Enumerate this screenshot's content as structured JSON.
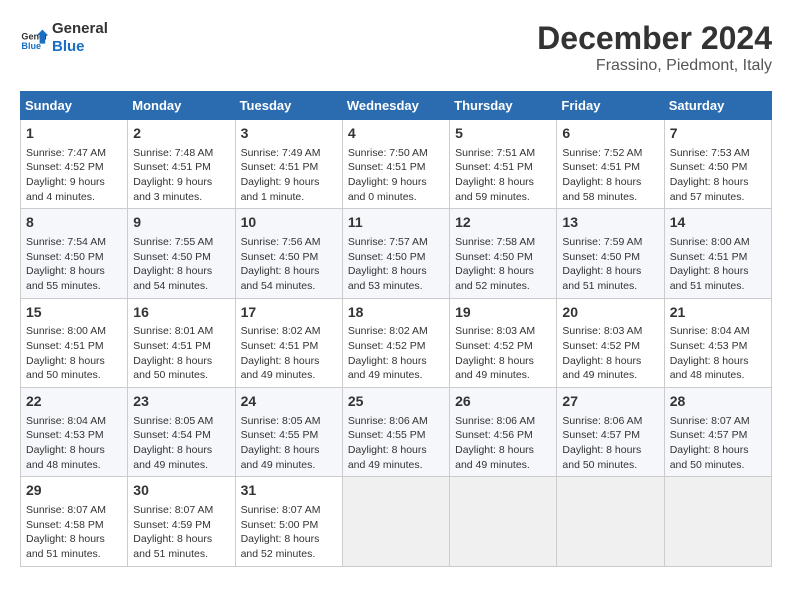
{
  "logo": {
    "line1": "General",
    "line2": "Blue"
  },
  "title": "December 2024",
  "subtitle": "Frassino, Piedmont, Italy",
  "days_of_week": [
    "Sunday",
    "Monday",
    "Tuesday",
    "Wednesday",
    "Thursday",
    "Friday",
    "Saturday"
  ],
  "weeks": [
    [
      {
        "day": "1",
        "info": "Sunrise: 7:47 AM\nSunset: 4:52 PM\nDaylight: 9 hours\nand 4 minutes."
      },
      {
        "day": "2",
        "info": "Sunrise: 7:48 AM\nSunset: 4:51 PM\nDaylight: 9 hours\nand 3 minutes."
      },
      {
        "day": "3",
        "info": "Sunrise: 7:49 AM\nSunset: 4:51 PM\nDaylight: 9 hours\nand 1 minute."
      },
      {
        "day": "4",
        "info": "Sunrise: 7:50 AM\nSunset: 4:51 PM\nDaylight: 9 hours\nand 0 minutes."
      },
      {
        "day": "5",
        "info": "Sunrise: 7:51 AM\nSunset: 4:51 PM\nDaylight: 8 hours\nand 59 minutes."
      },
      {
        "day": "6",
        "info": "Sunrise: 7:52 AM\nSunset: 4:51 PM\nDaylight: 8 hours\nand 58 minutes."
      },
      {
        "day": "7",
        "info": "Sunrise: 7:53 AM\nSunset: 4:50 PM\nDaylight: 8 hours\nand 57 minutes."
      }
    ],
    [
      {
        "day": "8",
        "info": "Sunrise: 7:54 AM\nSunset: 4:50 PM\nDaylight: 8 hours\nand 55 minutes."
      },
      {
        "day": "9",
        "info": "Sunrise: 7:55 AM\nSunset: 4:50 PM\nDaylight: 8 hours\nand 54 minutes."
      },
      {
        "day": "10",
        "info": "Sunrise: 7:56 AM\nSunset: 4:50 PM\nDaylight: 8 hours\nand 54 minutes."
      },
      {
        "day": "11",
        "info": "Sunrise: 7:57 AM\nSunset: 4:50 PM\nDaylight: 8 hours\nand 53 minutes."
      },
      {
        "day": "12",
        "info": "Sunrise: 7:58 AM\nSunset: 4:50 PM\nDaylight: 8 hours\nand 52 minutes."
      },
      {
        "day": "13",
        "info": "Sunrise: 7:59 AM\nSunset: 4:50 PM\nDaylight: 8 hours\nand 51 minutes."
      },
      {
        "day": "14",
        "info": "Sunrise: 8:00 AM\nSunset: 4:51 PM\nDaylight: 8 hours\nand 51 minutes."
      }
    ],
    [
      {
        "day": "15",
        "info": "Sunrise: 8:00 AM\nSunset: 4:51 PM\nDaylight: 8 hours\nand 50 minutes."
      },
      {
        "day": "16",
        "info": "Sunrise: 8:01 AM\nSunset: 4:51 PM\nDaylight: 8 hours\nand 50 minutes."
      },
      {
        "day": "17",
        "info": "Sunrise: 8:02 AM\nSunset: 4:51 PM\nDaylight: 8 hours\nand 49 minutes."
      },
      {
        "day": "18",
        "info": "Sunrise: 8:02 AM\nSunset: 4:52 PM\nDaylight: 8 hours\nand 49 minutes."
      },
      {
        "day": "19",
        "info": "Sunrise: 8:03 AM\nSunset: 4:52 PM\nDaylight: 8 hours\nand 49 minutes."
      },
      {
        "day": "20",
        "info": "Sunrise: 8:03 AM\nSunset: 4:52 PM\nDaylight: 8 hours\nand 49 minutes."
      },
      {
        "day": "21",
        "info": "Sunrise: 8:04 AM\nSunset: 4:53 PM\nDaylight: 8 hours\nand 48 minutes."
      }
    ],
    [
      {
        "day": "22",
        "info": "Sunrise: 8:04 AM\nSunset: 4:53 PM\nDaylight: 8 hours\nand 48 minutes."
      },
      {
        "day": "23",
        "info": "Sunrise: 8:05 AM\nSunset: 4:54 PM\nDaylight: 8 hours\nand 49 minutes."
      },
      {
        "day": "24",
        "info": "Sunrise: 8:05 AM\nSunset: 4:55 PM\nDaylight: 8 hours\nand 49 minutes."
      },
      {
        "day": "25",
        "info": "Sunrise: 8:06 AM\nSunset: 4:55 PM\nDaylight: 8 hours\nand 49 minutes."
      },
      {
        "day": "26",
        "info": "Sunrise: 8:06 AM\nSunset: 4:56 PM\nDaylight: 8 hours\nand 49 minutes."
      },
      {
        "day": "27",
        "info": "Sunrise: 8:06 AM\nSunset: 4:57 PM\nDaylight: 8 hours\nand 50 minutes."
      },
      {
        "day": "28",
        "info": "Sunrise: 8:07 AM\nSunset: 4:57 PM\nDaylight: 8 hours\nand 50 minutes."
      }
    ],
    [
      {
        "day": "29",
        "info": "Sunrise: 8:07 AM\nSunset: 4:58 PM\nDaylight: 8 hours\nand 51 minutes."
      },
      {
        "day": "30",
        "info": "Sunrise: 8:07 AM\nSunset: 4:59 PM\nDaylight: 8 hours\nand 51 minutes."
      },
      {
        "day": "31",
        "info": "Sunrise: 8:07 AM\nSunset: 5:00 PM\nDaylight: 8 hours\nand 52 minutes."
      },
      {
        "day": "",
        "info": ""
      },
      {
        "day": "",
        "info": ""
      },
      {
        "day": "",
        "info": ""
      },
      {
        "day": "",
        "info": ""
      }
    ]
  ]
}
